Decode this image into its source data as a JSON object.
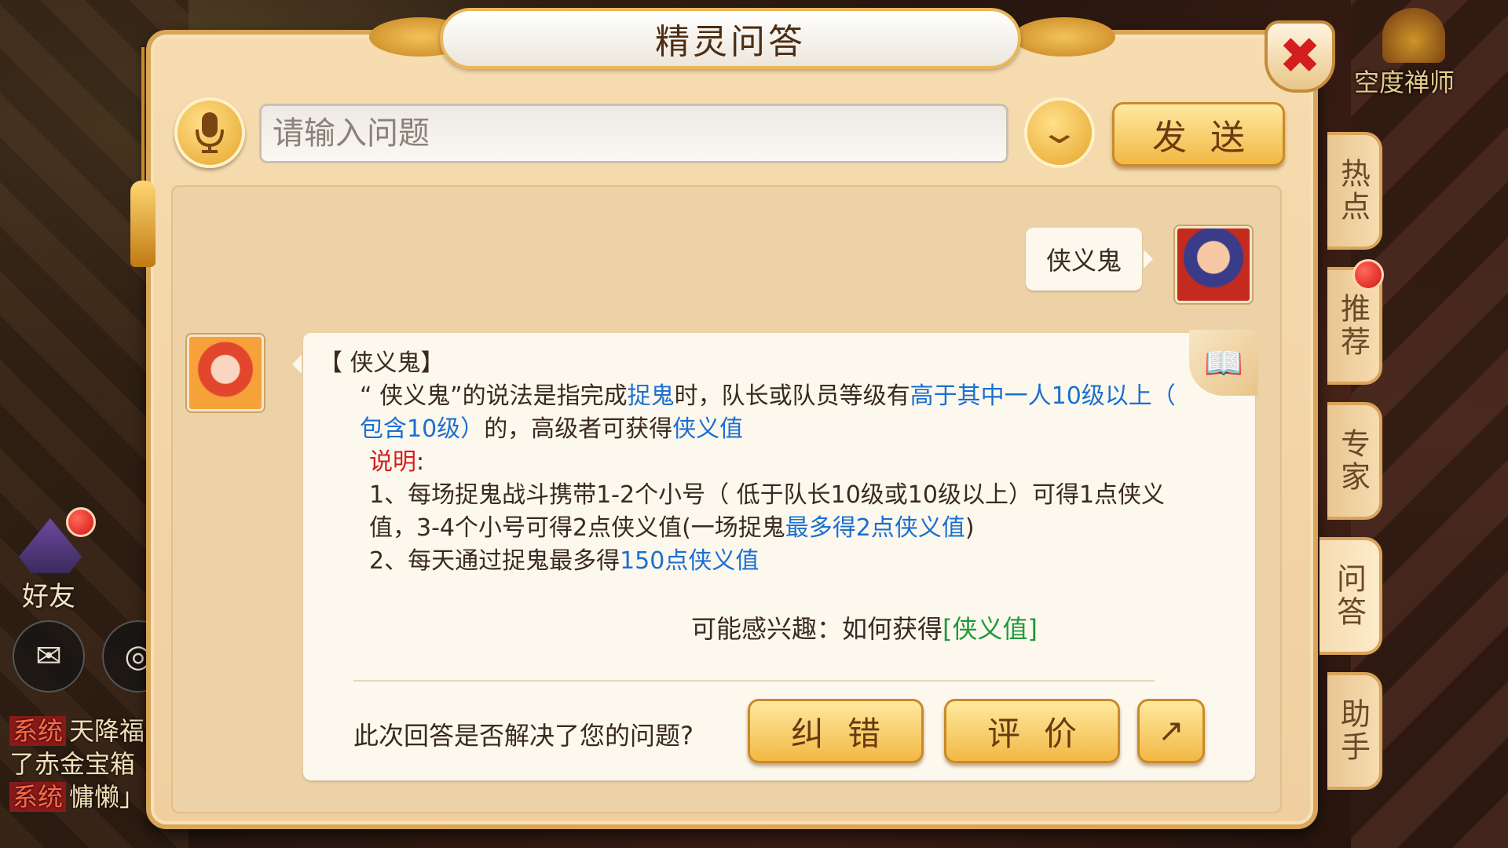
{
  "window": {
    "title": "精灵问答",
    "npc_name": "空度禅师"
  },
  "toolbar": {
    "mic_icon": "microphone-icon",
    "input_placeholder": "请输入问题",
    "dropdown_icon": "chevron-down-icon",
    "send_label": "发送"
  },
  "chat": {
    "user_message": "侠义鬼",
    "answer": {
      "heading": "【 侠义鬼】",
      "para1_a": "“ 侠义鬼”的说法是指完成",
      "para1_link1": "捉鬼",
      "para1_b": "时，队长或队员等级有",
      "para1_link2": "高于其中一人10级以上（ 包含10级）",
      "para1_c": "的，高级者可获得",
      "para1_link3": "侠义值",
      "note_label": "说明",
      "note_colon": ":",
      "item1_a": "1、每场捉鬼战斗携带1-2个小号（ 低于队长10级或10级以上）可得1点侠义值，3-4个小号可得2点侠义值(一场捉鬼",
      "item1_link": "最多得2点侠义值",
      "item1_b": ")",
      "item2_a": "2、每天通过捉鬼最多得",
      "item2_link": "150点侠义值",
      "related_prefix": "可能感兴趣：如何获得",
      "related_link": "[侠义值]"
    },
    "feedback_question": "此次回答是否解决了您的问题?",
    "fix_label": "纠错",
    "rate_label": "评价",
    "share_icon": "share-icon"
  },
  "side_tabs": [
    {
      "label": "热点"
    },
    {
      "label": "推荐"
    },
    {
      "label": "专家"
    },
    {
      "label": "问答"
    },
    {
      "label": "助手"
    }
  ],
  "hud": {
    "friend_label": "好友",
    "chat_lines": [
      {
        "tag": "系统",
        "text": "天降福"
      },
      {
        "tag": "",
        "text": "了赤金宝箱"
      },
      {
        "tag": "系统",
        "text": "慵懒」"
      }
    ]
  },
  "colors": {
    "link": "#1a6fd0",
    "note": "#d41e1e",
    "related": "#1f9a3a",
    "close": "#d41e1e"
  }
}
